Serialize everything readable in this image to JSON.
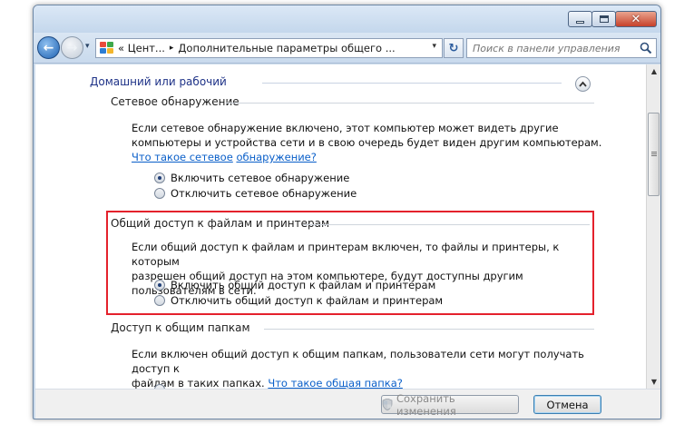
{
  "window": {
    "controls": {
      "minimize": "minimize",
      "maximize": "maximize",
      "close": "close"
    }
  },
  "address_bar": {
    "recent_arrow": "▾",
    "crumb_prefix": "« Цент...",
    "crumb_separator": "▸",
    "crumb_current": "Дополнительные параметры общего ...",
    "dropdown": "▾",
    "refresh_glyph": "↻"
  },
  "search": {
    "placeholder": "Поиск в панели управления"
  },
  "profile_group": {
    "title": "Домашний или рабочий"
  },
  "sections": {
    "network_discovery": {
      "title": "Сетевое обнаружение",
      "description": "Если сетевое обнаружение включено, этот компьютер может видеть другие компьютеры и устройства сети и в свою очередь будет виден другим компьютерам.",
      "link_part1": "Что такое сетевое",
      "link_part2": "обнаружение?",
      "options": [
        {
          "label": "Включить сетевое обнаружение",
          "selected": true
        },
        {
          "label": "Отключить сетевое обнаружение",
          "selected": false
        }
      ]
    },
    "file_printer_sharing": {
      "title": "Общий доступ к файлам и принтерам",
      "description_line1": "Если общий доступ к файлам и принтерам включен, то файлы и принтеры, к которым",
      "description_line2": "разрешен общий доступ на этом компьютере, будут доступны другим пользователям в сети.",
      "options": [
        {
          "label": "Включить общий доступ к файлам и принтерам",
          "selected": true
        },
        {
          "label": "Отключить общий доступ к файлам и принтерам",
          "selected": false
        }
      ],
      "highlight_color": "#e4212c"
    },
    "public_folders": {
      "title": "Доступ к общим папкам",
      "description_line1": "Если включен общий доступ к общим папкам, пользователи сети могут получать доступ к",
      "description_line2": "файлам в таких папках.",
      "link": "Что такое общая папка?"
    }
  },
  "footer": {
    "save_label": "Сохранить изменения",
    "cancel_label": "Отмена"
  },
  "colors": {
    "group_heading": "#1e3287",
    "link": "#0a5fc9",
    "window_frame": "#cddcec"
  }
}
